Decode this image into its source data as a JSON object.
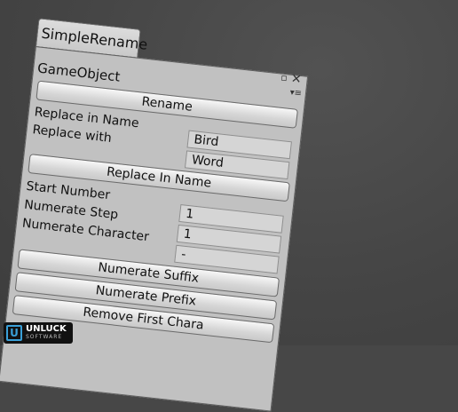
{
  "tab_title": "SimpleRename",
  "window_icons": {
    "maximize": "▫",
    "close": "✕",
    "menu": "▾≡"
  },
  "object_label": "GameObject",
  "buttons": {
    "rename": "Rename",
    "replace_in_name": "Replace In Name",
    "numerate_suffix": "Numerate Suffix",
    "numerate_prefix": "Numerate Prefix",
    "remove_first": "Remove First Chara"
  },
  "labels": {
    "replace_in_name": "Replace in Name",
    "replace_with": "Replace with",
    "start_number": "Start Number",
    "numerate_step": "Numerate Step",
    "numerate_character": "Numerate Character"
  },
  "fields": {
    "replace_in_name": "Bird",
    "replace_with": "Word",
    "numerate_step": "1",
    "numerate_character": "1",
    "separator": "-"
  },
  "logo": {
    "brand": "UNLUCK",
    "sub": "SOFTWARE",
    "mark": "U"
  },
  "colors": {
    "background": "#474747",
    "window": "#c1c1c1",
    "logo_accent": "#3aa0d8"
  }
}
